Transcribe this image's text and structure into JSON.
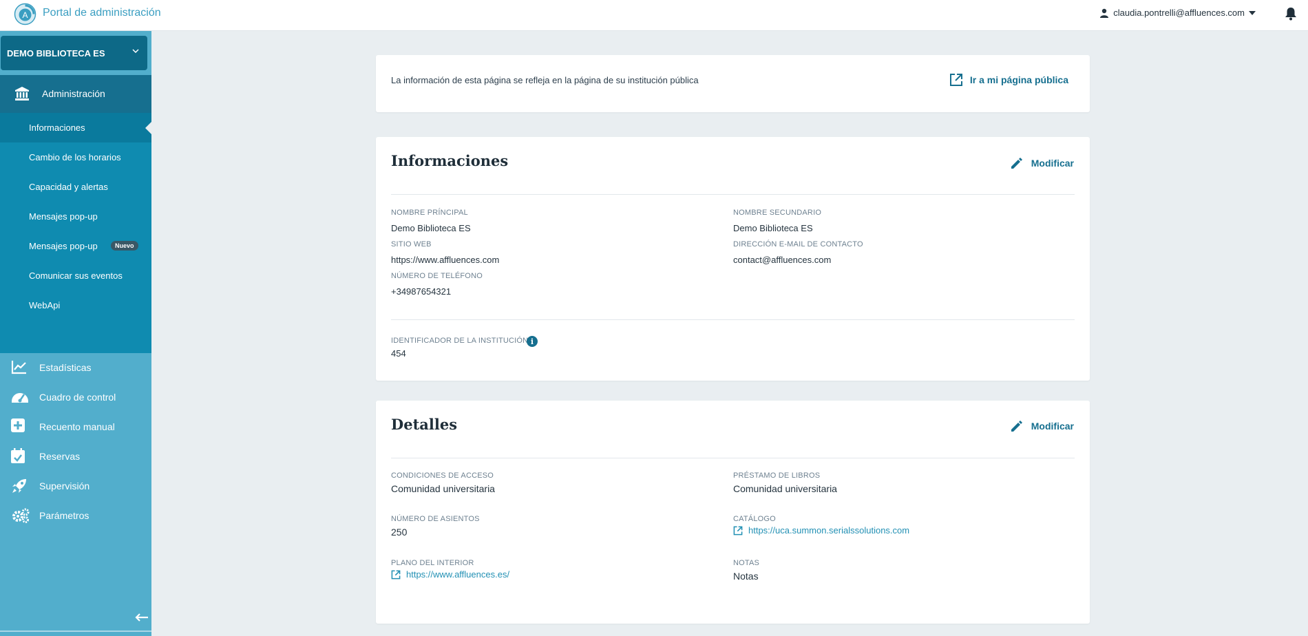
{
  "header": {
    "app_title": "Portal de administración",
    "user_email": "claudia.pontrelli@affluences.com"
  },
  "sidebar": {
    "institution": "DEMO BIBLIOTECA ES",
    "admin_label": "Administración",
    "sub_items": [
      {
        "label": "Informaciones",
        "active": true
      },
      {
        "label": "Cambio de los horarios"
      },
      {
        "label": "Capacidad y alertas"
      },
      {
        "label": "Mensajes pop-up"
      },
      {
        "label": "Mensajes pop-up",
        "badge": "Nuevo"
      },
      {
        "label": "Comunicar sus eventos"
      },
      {
        "label": "WebApi"
      }
    ],
    "main_items": [
      {
        "label": "Estadísticas",
        "icon": "chart-line-icon"
      },
      {
        "label": "Cuadro de control",
        "icon": "gauge-icon"
      },
      {
        "label": "Recuento manual",
        "icon": "plus-box-icon"
      },
      {
        "label": "Reservas",
        "icon": "calendar-check-icon"
      },
      {
        "label": "Supervisión",
        "icon": "rocket-icon"
      },
      {
        "label": "Parámetros",
        "icon": "gears-icon"
      }
    ]
  },
  "notice": {
    "text": "La información de esta página se refleja en la página de su institución pública",
    "link_label": "Ir a mi página pública"
  },
  "info": {
    "title": "Informaciones",
    "modify_label": "Modificar",
    "fields": {
      "main_name_label": "NOMBRE PRÍNCIPAL",
      "main_name": "Demo Biblioteca ES",
      "secondary_name_label": "NOMBRE SECUNDARIO",
      "secondary_name": "Demo Biblioteca ES",
      "website_label": "SITIO WEB",
      "website": "https://www.affluences.com",
      "email_label": "DIRECCIÓN E-MAIL DE CONTACTO",
      "email": "contact@affluences.com",
      "phone_label": "NÚMERO DE TELÉFONO",
      "phone": "+34987654321",
      "id_label": "IDENTIFICADOR DE LA INSTITUCIÓN",
      "id": "454"
    }
  },
  "details": {
    "title": "Detalles",
    "modify_label": "Modificar",
    "fields": {
      "access_label": "CONDICIONES DE ACCESO",
      "access": "Comunidad universitaria",
      "loan_label": "PRÉSTAMO DE LIBROS",
      "loan": "Comunidad universitaria",
      "seats_label": "NÚMERO DE ASIENTOS",
      "seats": "250",
      "catalog_label": "CATÁLOGO",
      "catalog": "https://uca.summon.serialssolutions.com",
      "floorplan_label": "PLANO DEL INTERIOR",
      "floorplan": "https://www.affluences.es/",
      "notes_label": "NOTAS",
      "notes": "Notas"
    }
  },
  "colors": {
    "primary": "#166f8f",
    "sidebar": "#52aecc",
    "sidebar_admin": "#0f8bb0",
    "link": "#2290b4"
  }
}
